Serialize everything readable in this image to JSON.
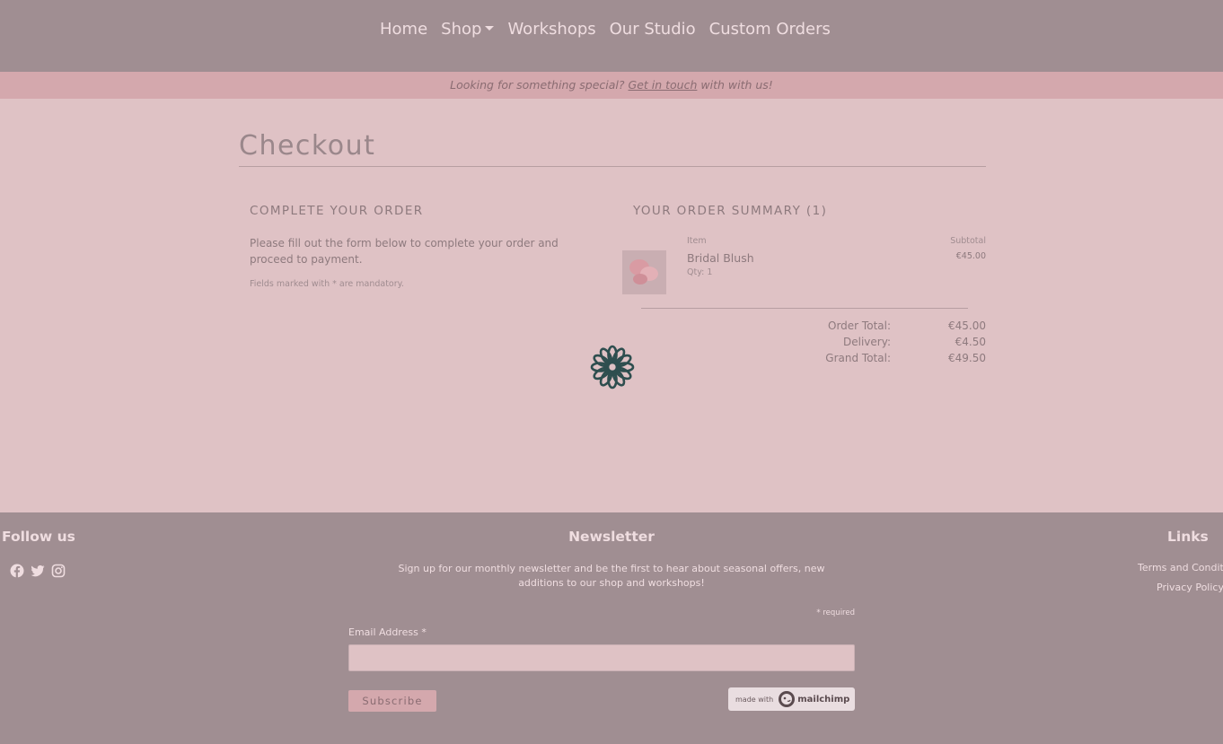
{
  "nav": {
    "items": [
      {
        "label": "Home"
      },
      {
        "label": "Shop",
        "dropdown": true
      },
      {
        "label": "Workshops"
      },
      {
        "label": "Our Studio"
      },
      {
        "label": "Custom Orders"
      }
    ]
  },
  "banner": {
    "before": "Looking for something special?",
    "link": "Get in touch",
    "after": "with with us!"
  },
  "checkout": {
    "title": "Checkout",
    "left": {
      "heading": "COMPLETE YOUR ORDER",
      "text": "Please fill out the form below to complete your order and proceed to payment.",
      "note": "Fields marked with * are mandatory."
    },
    "summary": {
      "heading": "YOUR ORDER SUMMARY (1)",
      "item_header": "Item",
      "subtotal_header": "Subtotal",
      "items": [
        {
          "name": "Bridal Blush",
          "qty": "Qty: 1",
          "price": "€45.00"
        }
      ],
      "totals": [
        {
          "label": "Order Total:",
          "value": "€45.00"
        },
        {
          "label": "Delivery:",
          "value": "€4.50"
        },
        {
          "label": "Grand Total:",
          "value": "€49.50"
        }
      ]
    }
  },
  "footer": {
    "follow_heading": "Follow us",
    "social_icons": [
      "facebook-icon",
      "twitter-icon",
      "instagram-icon"
    ],
    "newsletter": {
      "heading": "Newsletter",
      "text": "Sign up for our monthly newsletter and be the first to hear about seasonal offers, new additions to our shop and workshops!",
      "required_note": "* required",
      "email_label": "Email Address",
      "email_required_marker": "*",
      "email_value": "",
      "subscribe_label": "Subscribe",
      "badge_made_with": "made with",
      "badge_brand": "mailchimp"
    },
    "links_heading": "Links",
    "links": [
      "Terms and Conditions",
      "Privacy Policy"
    ]
  },
  "colors": {
    "navbar": "#a08e92",
    "banner": "#d4a8ad",
    "page_bg": "#dfc2c5",
    "spinner": "#2e4e4f"
  }
}
